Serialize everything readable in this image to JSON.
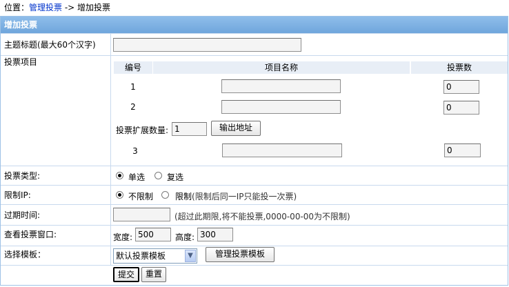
{
  "breadcrumb": {
    "prefix": "位置：",
    "link": "管理投票",
    "sep": " -> ",
    "current": "增加投票"
  },
  "panel_title": "增加投票",
  "subject": {
    "label": "主题标题(最大60个汉字)",
    "value": ""
  },
  "items": {
    "label": "投票项目",
    "headers": {
      "num": "编号",
      "name": "项目名称",
      "votes": "投票数"
    },
    "rows": [
      {
        "num": "1",
        "name": "",
        "votes": "0"
      },
      {
        "num": "2",
        "name": "",
        "votes": "0"
      }
    ],
    "extra_row": {
      "num": "3",
      "name": "",
      "votes": "0"
    },
    "expand_label": "投票扩展数量:",
    "expand_value": "1",
    "output_button": "输出地址"
  },
  "vote_type": {
    "label": "投票类型:",
    "options": [
      "单选",
      "复选"
    ],
    "selected": 0
  },
  "ip_limit": {
    "label": "限制IP:",
    "options": [
      "不限制",
      "限制"
    ],
    "note": "(限制后同一IP只能投一次票)",
    "selected": 0
  },
  "expire": {
    "label": "过期时间:",
    "value": "",
    "hint": "(超过此期限,将不能投票,0000-00-00为不限制)"
  },
  "window": {
    "label": "查看投票窗口:",
    "width_label": "宽度:",
    "width_value": "500",
    "height_label": "高度:",
    "height_value": "300"
  },
  "template": {
    "label": "选择模板：",
    "selected": "默认投票模板",
    "manage_button": "管理投票模板"
  },
  "actions": {
    "submit": "提交",
    "reset": "重置"
  }
}
